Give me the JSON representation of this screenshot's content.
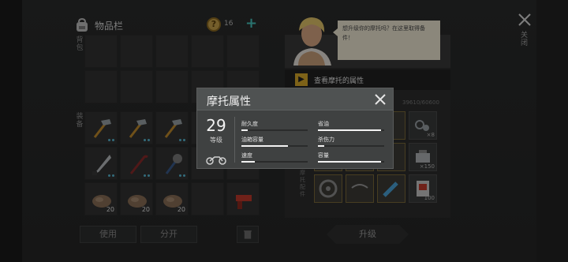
{
  "inventory": {
    "title": "物品栏",
    "coin_symbol": "?",
    "coin_count": "16",
    "plus": "+",
    "side_label_top": "背包",
    "side_label_bottom": "装备",
    "bottom_counts": [
      "20",
      "20",
      "20"
    ],
    "buttons": {
      "use": "使用",
      "split": "分开"
    }
  },
  "npc": {
    "speech": "想升级你的摩托吗？在这里取得备件！",
    "see_attributes": "查看摩托的属性",
    "stat_text": "39610/60600",
    "side_label": "摩托配件",
    "upgrade": "升级",
    "counts": [
      "×8",
      "×150",
      "100"
    ]
  },
  "close": {
    "label": "关闭"
  },
  "modal": {
    "title": "摩托属性",
    "level_value": "29",
    "level_label": "等级",
    "stats": [
      {
        "label": "耐久度",
        "fill": 0.1
      },
      {
        "label": "油箱容量",
        "fill": 0.7
      },
      {
        "label": "速度",
        "fill": 0.2
      },
      {
        "label": "省油",
        "fill": 0.95
      },
      {
        "label": "杀伤力",
        "fill": 0.1
      },
      {
        "label": "容量",
        "fill": 0.95
      }
    ]
  },
  "colors": {
    "accent": "#48c7c0",
    "gold": "#d8a92a",
    "bar": "#f2f2f2"
  }
}
